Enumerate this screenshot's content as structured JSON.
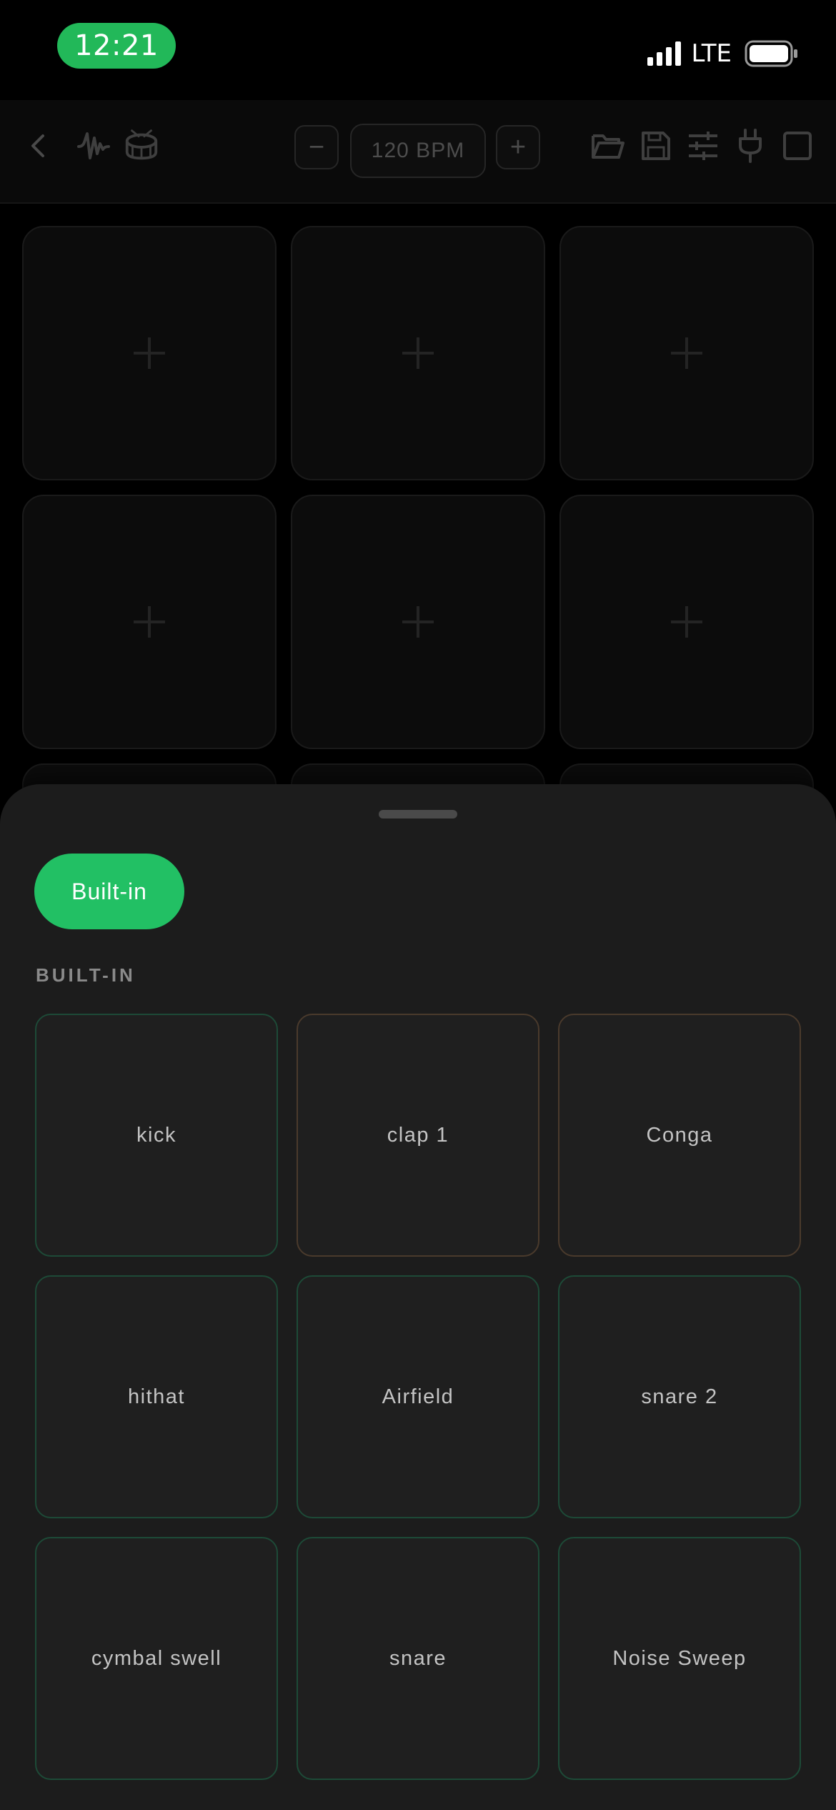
{
  "status_bar": {
    "time": "12:21",
    "network": "LTE"
  },
  "toolbar": {
    "bpm": "120 BPM",
    "minus_label": "−",
    "plus_label": "+"
  },
  "icons": {
    "back": "chevron-left-icon",
    "waveform": "waveform-icon",
    "drum": "drum-icon",
    "folder": "folder-open-icon",
    "save": "save-icon",
    "sliders": "sliders-icon",
    "plug": "plug-icon",
    "stop": "stop-icon",
    "add": "plus-icon"
  },
  "pads": {
    "count_visible": 6
  },
  "sheet": {
    "active_tab": "Built-in",
    "section_title": "BUILT-IN",
    "samples": [
      {
        "label": "kick",
        "accent": "#1d4a37"
      },
      {
        "label": "clap 1",
        "accent": "#4a3a2c"
      },
      {
        "label": "Conga",
        "accent": "#4a3a2c"
      },
      {
        "label": "hithat",
        "accent": "#1d4a37"
      },
      {
        "label": "Airfield",
        "accent": "#1d4a37"
      },
      {
        "label": "snare 2",
        "accent": "#1d4a37"
      },
      {
        "label": "cymbal swell",
        "accent": "#1d4a37"
      },
      {
        "label": "snare",
        "accent": "#1d4a37"
      },
      {
        "label": "Noise Sweep",
        "accent": "#1d4a37"
      }
    ]
  },
  "colors": {
    "accent_green": "#22c064",
    "time_pill": "#22b859",
    "sheet_bg": "#1c1c1c"
  }
}
